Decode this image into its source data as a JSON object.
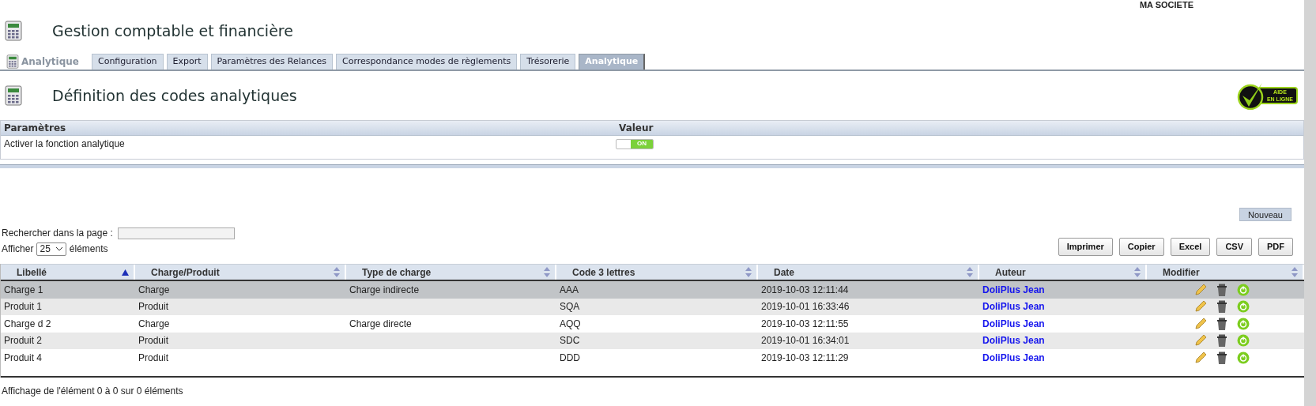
{
  "header": {
    "company": "MA SOCIETE"
  },
  "page_title": "Gestion comptable et financière",
  "tabs_label": "Analytique",
  "tabs": [
    {
      "label": "Configuration",
      "selected": false
    },
    {
      "label": "Export",
      "selected": false
    },
    {
      "label": "Paramètres des Relances",
      "selected": false
    },
    {
      "label": "Correspondance modes de règlements",
      "selected": false
    },
    {
      "label": "Trésorerie",
      "selected": false
    },
    {
      "label": "Analytique",
      "selected": true
    }
  ],
  "section_title": "Définition des codes analytiques",
  "help_badge": [
    "AIDE",
    "EN LIGNE"
  ],
  "settings": {
    "columns": [
      "Paramètres",
      "Valeur"
    ],
    "rows": [
      {
        "label": "Activer la fonction analytique",
        "on": true,
        "toggle_text": "ON"
      }
    ]
  },
  "new_button": "Nouveau",
  "search": {
    "label": "Rechercher dans la page  :"
  },
  "page_size": {
    "before": "Afficher",
    "value": "25",
    "after": "éléments"
  },
  "export_buttons": [
    "Imprimer",
    "Copier",
    "Excel",
    "CSV",
    "PDF"
  ],
  "table": {
    "columns": [
      {
        "label": "Libellé",
        "sorted": true
      },
      {
        "label": "Charge/Produit",
        "sorted": false
      },
      {
        "label": "Type de charge",
        "sorted": false
      },
      {
        "label": "Code 3 lettres",
        "sorted": false
      },
      {
        "label": "Date",
        "sorted": false
      },
      {
        "label": "Auteur",
        "sorted": false
      },
      {
        "label": "Modifier",
        "sorted": false
      }
    ],
    "rows": [
      {
        "selected": true,
        "cells": [
          "Charge 1",
          "Charge",
          "Charge indirecte",
          "AAA",
          "2019-10-03 12:11:44"
        ],
        "author": "DoliPlus Jean"
      },
      {
        "selected": false,
        "cells": [
          "Produit 1",
          "Produit",
          "",
          "SQA",
          "2019-10-01 16:33:46"
        ],
        "author": "DoliPlus Jean"
      },
      {
        "selected": false,
        "cells": [
          "Charge d 2",
          "Charge",
          "Charge directe",
          "AQQ",
          "2019-10-03 12:11:55"
        ],
        "author": "DoliPlus Jean"
      },
      {
        "selected": false,
        "cells": [
          "Produit 2",
          "Produit",
          "",
          "SDC",
          "2019-10-01 16:34:01"
        ],
        "author": "DoliPlus Jean"
      },
      {
        "selected": false,
        "cells": [
          "Produit 4",
          "Produit",
          "",
          "DDD",
          "2019-10-03 12:11:29"
        ],
        "author": "DoliPlus Jean"
      }
    ]
  },
  "footer": "Affichage de l'élément 0 à 0 sur 0 éléments"
}
